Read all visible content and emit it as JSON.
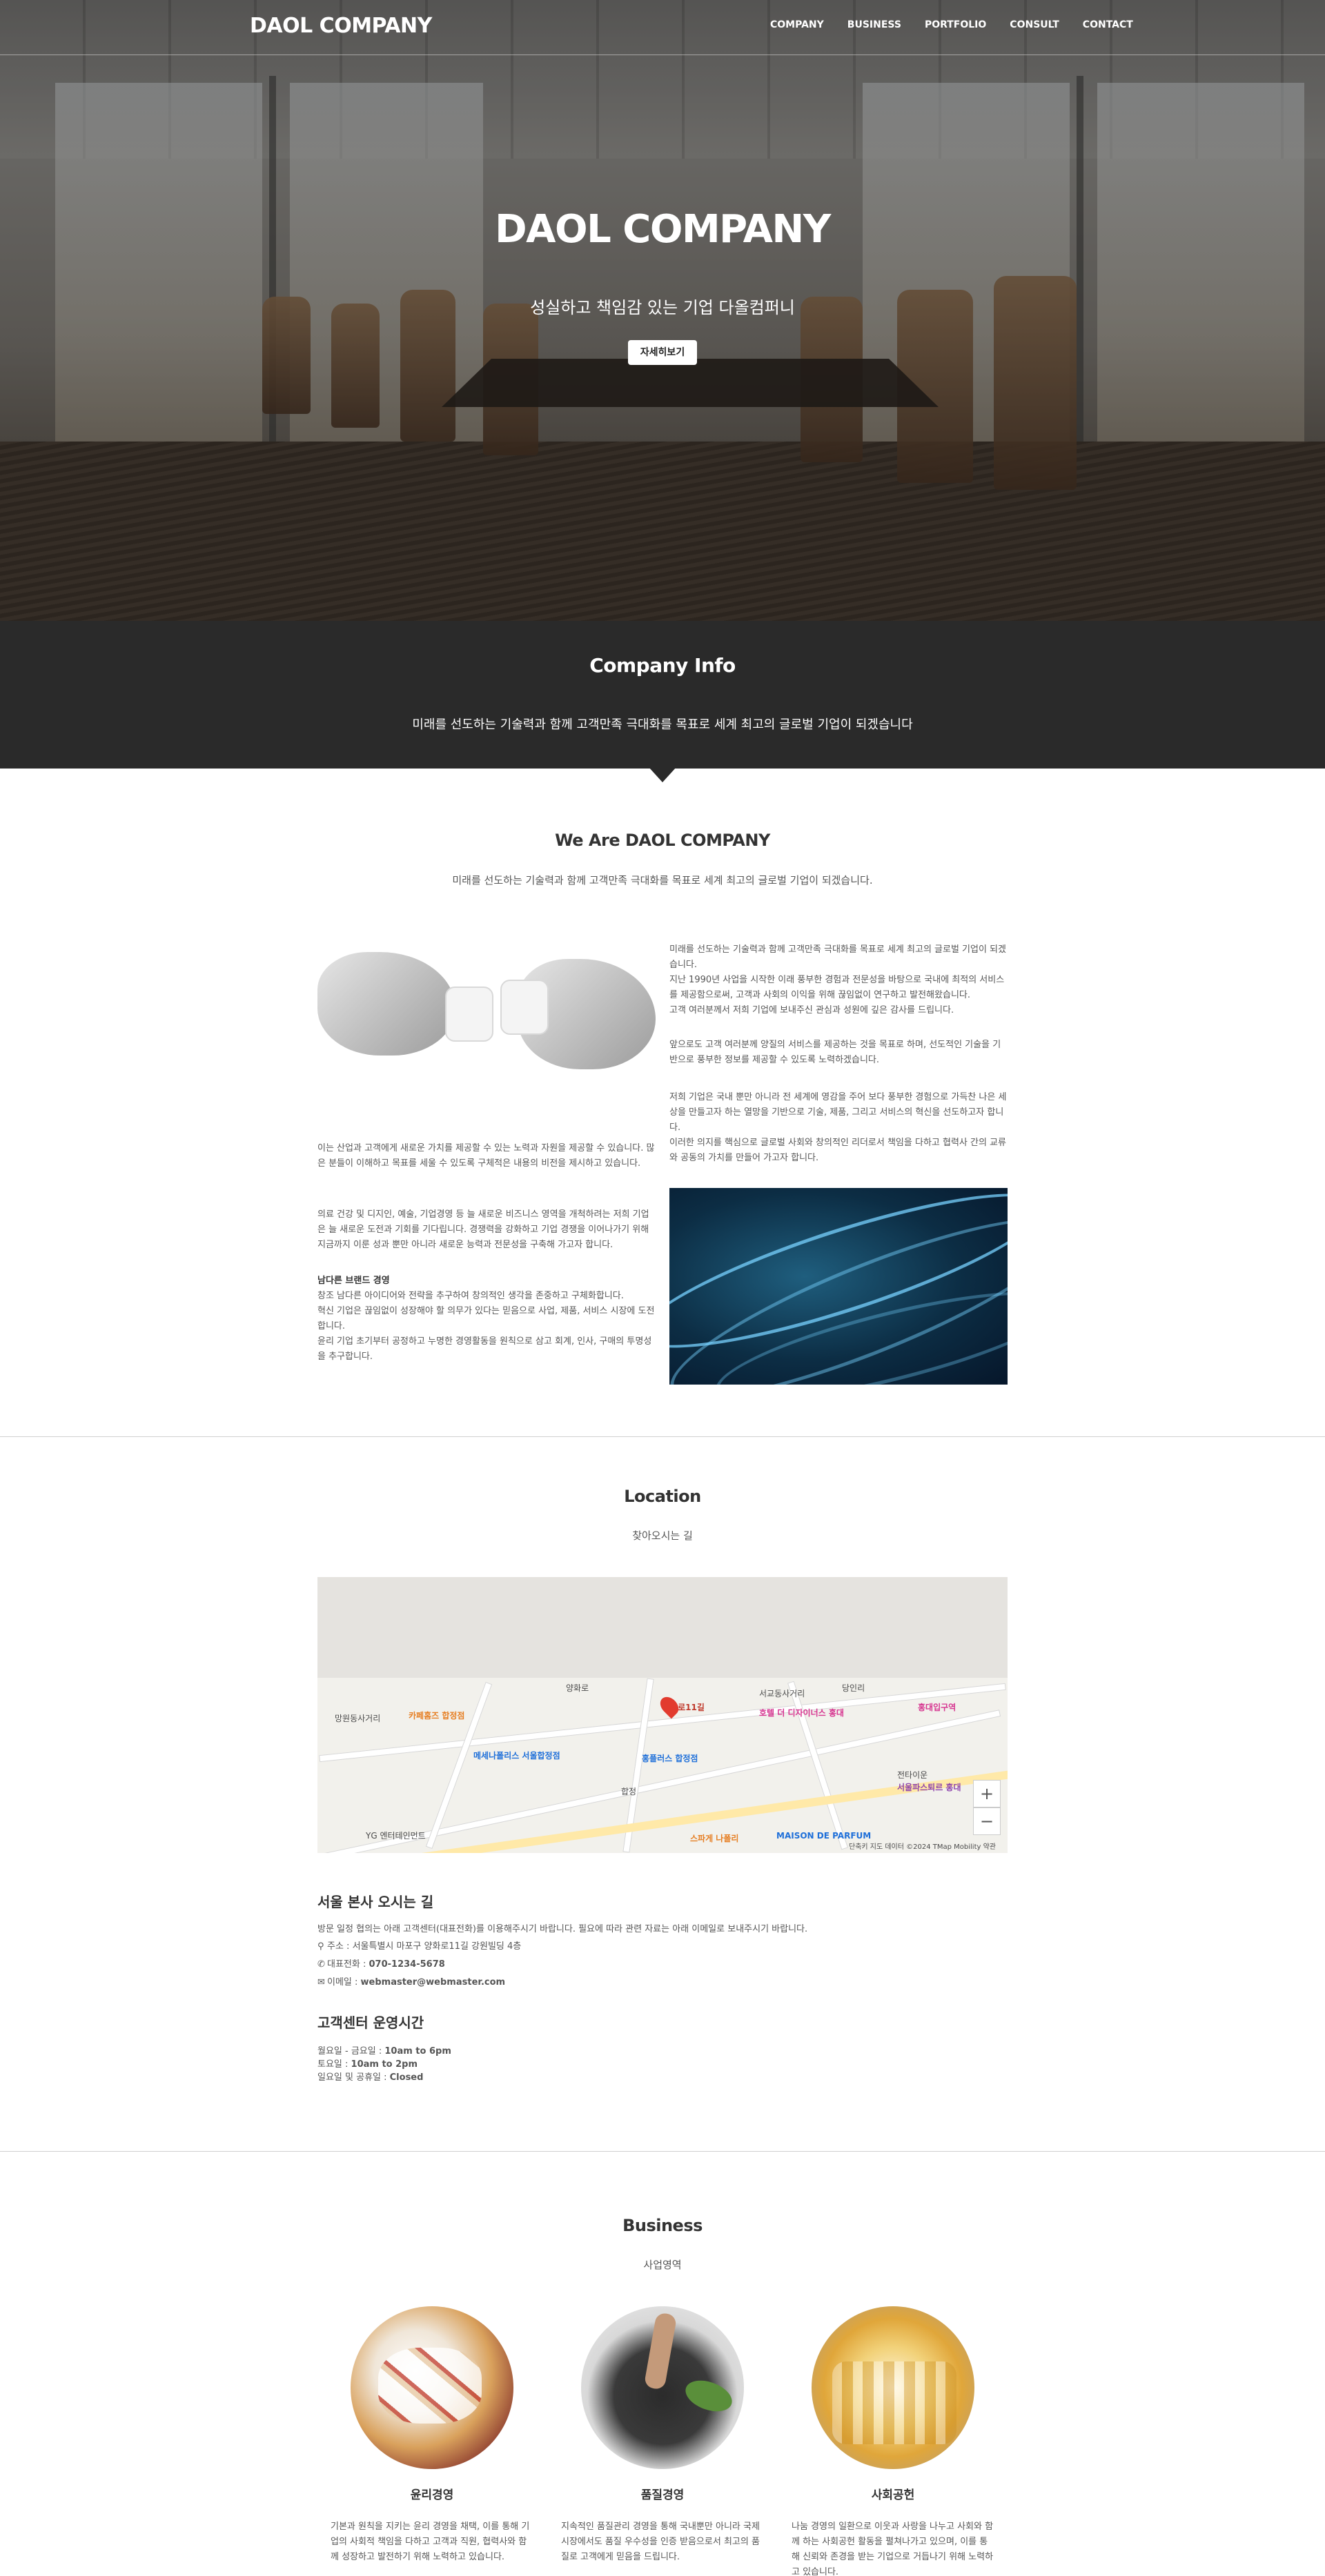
{
  "header": {
    "logo": "DAOL COMPANY",
    "menu": [
      "COMPANY",
      "BUSINESS",
      "PORTFOLIO",
      "CONSULT",
      "CONTACT"
    ]
  },
  "hero": {
    "title": "DAOL COMPANY",
    "subtitle": "성실하고 책임감 있는 기업 다올컴퍼니",
    "button": "자세히보기"
  },
  "info": {
    "title": "Company Info",
    "text": "미래를 선도하는 기술력과 함께 고객만족 극대화를 목표로 세계 최고의 글로벌 기업이 되겠습니다"
  },
  "weare": {
    "title": "We Are DAOL COMPANY",
    "subtitle": "미래를 선도하는 기술력과 함께 고객만족 극대화를 목표로 세계 최고의 글로벌 기업이 되겠습니다.",
    "right_paragraphs": [
      "미래를 선도하는 기술력과 함께 고객만족 극대화를 목표로 세계 최고의 글로벌 기업이 되겠습니다.\n지난 1990년 사업을 시작한 이래 풍부한 경험과 전문성을 바탕으로 국내에 최적의 서비스를 제공함으로써, 고객과 사회의 이익을 위해 끊임없이 연구하고 발전해왔습니다.\n고객 여러분께서 저희 기업에 보내주신 관심과 성원에 깊은 감사를 드립니다.",
      "앞으로도 고객 여러분께 양질의 서비스를 제공하는 것을 목표로 하며, 선도적인 기술을 기반으로 풍부한 정보를 제공할 수 있도록 노력하겠습니다.",
      "저희 기업은 국내 뿐만 아니라 전 세계에 영감을 주어 보다 풍부한 경험으로 가득찬 나은 세상을 만들고자 하는 열망을 기반으로 기술, 제품, 그리고 서비스의 혁신을 선도하고자 합니다.\n이러한 의지를 핵심으로 글로벌 사회와 창의적인 리더로서 책임을 다하고 협력사 간의 교류와 공동의 가치를 만들어 가고자 합니다."
    ],
    "left_paragraphs": [
      "이는 산업과 고객에게 새로운 가치를 제공할 수 있는 노력과 자원을 제공할 수 있습니다. 많은 분들이 이해하고 목표를 세울 수 있도록 구체적은 내용의 비전을 제시하고 있습니다.",
      "의료 건강 및 디지인, 예술, 기업경영 등 늘 새로운 비즈니스 영역을 개척하려는 저희 기업은 늘 새로운 도전과 기회를 기다립니다. 경쟁력을 강화하고 기업 경쟁을 이어나가기 위해 지금까지 이룬 성과 뿐만 아니라 새로운 능력과 전문성을 구축해 가고자 합니다."
    ],
    "brand_heading": "남다른 브랜드 경영",
    "brand_text": "창조 남다른 아이디어와 전략을 추구하여 창의적인 생각을 존중하고 구체화합니다.\n혁신 기업은 끊임없이 성장해야 할 의무가 있다는 믿음으로 사업, 제품, 서비스 시장에 도전합니다.\n윤리 기업 초기부터 공정하고 누명한 경영활동을 원칙으로 삼고 회계, 인사, 구매의 투명성을 추구합니다."
  },
  "location": {
    "title": "Location",
    "subtitle": "찾아오시는 길",
    "map": {
      "labels": [
        "양화로11길",
        "서교동사거리",
        "호텔 더 디자이너스 홍대",
        "카페홈즈 합정점",
        "홍플러스 합정점",
        "메세나폴리스 서울합정점",
        "합정",
        "스파게 나폴리",
        "서울파스퇴르 홍대",
        "홍대입구역",
        "MAISON DE PARFUM",
        "YG 엔터테인먼트",
        "망원동사거리",
        "당인리",
        "전타이운",
        "양화로"
      ],
      "copyright": "단축키  지도 데이터 ©2024 TMap Mobility  약관",
      "zoom_in": "+",
      "zoom_out": "−"
    },
    "hq_heading": "서울 본사 오시는 길",
    "hq_desc": "방문 일정 협의는 아래 고객센터(대표전화)를 이용해주시기 바랍니다. 필요에 따라 관련 자료는 아래 이메일로 보내주시기 바랍니다.",
    "address_label": "주소 : ",
    "address": "서울특별시 마포구 양화로11길 강원빌딩 4층",
    "phone_label": "대표전화 : ",
    "phone": "070-1234-5678",
    "email_label": "이메일 : ",
    "email": "webmaster@webmaster.com",
    "hours_heading": "고객센터 운영시간",
    "hours": [
      {
        "label": "월요일 - 금요일 : ",
        "value": "10am to 6pm"
      },
      {
        "label": "토요일 : ",
        "value": "10am to 2pm"
      },
      {
        "label": "일요일 및 공휴일 : ",
        "value": "Closed"
      }
    ]
  },
  "business": {
    "title": "Business",
    "subtitle": "사업영역",
    "items": [
      {
        "title": "윤리경영",
        "text": "기본과 원칙을 지키는 윤리 경영을 채택, 이를 통해 기업의 사회적 책임을 다하고 고객과 직원, 협력사와 함께 성장하고 발전하기 위해 노력하고 있습니다."
      },
      {
        "title": "품질경영",
        "text": "지속적인 품질관리 경영을 통해 국내뿐만 아니라 국제시장에서도 품질 우수성을 인증 받음으로서 최고의 품질로 고객에게 믿음을 드립니다."
      },
      {
        "title": "사회공헌",
        "text": "나눔 경영의 일환으로 이웃과 사랑을 나누고 사회와 함께 하는 사회공헌 활동을 펼쳐나가고 있으며, 이를 통해 신뢰와 존경을 받는 기업으로 거듭나기 위해 노력하고 있습니다."
      }
    ]
  },
  "colors": {
    "dark_band": "#2a2a2a",
    "map_pin": "#e23b2e"
  }
}
